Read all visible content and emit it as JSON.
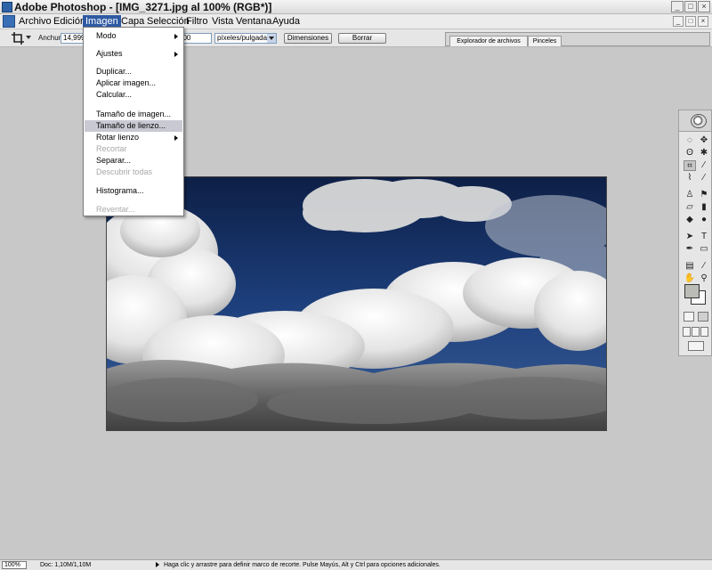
{
  "window": {
    "title": "Adobe Photoshop - [IMG_3271.jpg al 100% (RGB*)]",
    "controls": [
      "_",
      "□",
      "×"
    ]
  },
  "menubar": {
    "items": [
      "Archivo",
      "Edición",
      "Imagen",
      "Capa",
      "Selección",
      "Filtro",
      "Vista",
      "Ventana",
      "Ayuda"
    ],
    "active": "Imagen",
    "doc_controls": [
      "_",
      "□",
      "×"
    ]
  },
  "options_bar": {
    "tool_icon": "crop-tool-icon",
    "width_label": "Anchura:",
    "width_value": "14,999",
    "resolution_value": "200",
    "units_select": "píxeles/pulgada",
    "dimensions_button": "Dimensiones",
    "clear_button": "Borrar",
    "palette_tabs": [
      "Explorador de archivos",
      "Pinceles"
    ]
  },
  "image_menu": {
    "items": [
      {
        "label": "Modo",
        "submenu": true
      },
      {
        "label": "Ajustes",
        "submenu": true
      },
      {
        "label": "Duplicar..."
      },
      {
        "label": "Aplicar imagen..."
      },
      {
        "label": "Calcular..."
      },
      {
        "label": "Tamaño de imagen..."
      },
      {
        "label": "Tamaño de lienzo...",
        "highlighted": true
      },
      {
        "label": "Rotar lienzo",
        "submenu": true
      },
      {
        "label": "Recortar",
        "disabled": true
      },
      {
        "label": "Separar..."
      },
      {
        "label": "Descubrir todas",
        "disabled": true
      },
      {
        "label": "Histograma..."
      },
      {
        "label": "Reventar...",
        "disabled": true
      }
    ]
  },
  "toolbox": {
    "tools": [
      {
        "icon": "marquee-icon",
        "glyph": "◌"
      },
      {
        "icon": "move-icon",
        "glyph": "✥"
      },
      {
        "icon": "lasso-icon",
        "glyph": "ʘ"
      },
      {
        "icon": "magic-wand-icon",
        "glyph": "✱"
      },
      {
        "icon": "crop-icon",
        "glyph": "⌗",
        "selected": true
      },
      {
        "icon": "slice-icon",
        "glyph": "⁄"
      },
      {
        "icon": "healing-brush-icon",
        "glyph": "⌇"
      },
      {
        "icon": "brush-icon",
        "glyph": "⁄"
      },
      {
        "icon": "clone-stamp-icon",
        "glyph": "♙"
      },
      {
        "icon": "history-brush-icon",
        "glyph": "⚑"
      },
      {
        "icon": "eraser-icon",
        "glyph": "▱"
      },
      {
        "icon": "gradient-icon",
        "glyph": "▮"
      },
      {
        "icon": "blur-icon",
        "glyph": "◆"
      },
      {
        "icon": "dodge-icon",
        "glyph": "●"
      },
      {
        "icon": "path-select-icon",
        "glyph": "➤"
      },
      {
        "icon": "type-icon",
        "glyph": "T"
      },
      {
        "icon": "pen-icon",
        "glyph": "✒"
      },
      {
        "icon": "rectangle-shape-icon",
        "glyph": "▭"
      },
      {
        "icon": "notes-icon",
        "glyph": "▤"
      },
      {
        "icon": "eyedropper-icon",
        "glyph": "⁄"
      },
      {
        "icon": "hand-icon",
        "glyph": "✋"
      },
      {
        "icon": "zoom-icon",
        "glyph": "⚲"
      }
    ],
    "foreground_color": "#bcbcb6",
    "background_color": "#fbfbfb"
  },
  "statusbar": {
    "zoom": "100%",
    "doc_info": "Doc: 1,10M/1,10M",
    "hint": "Haga clic y arrastre para definir marco de recorte. Pulse Mayús, Alt y Ctrl para opciones adicionales."
  }
}
